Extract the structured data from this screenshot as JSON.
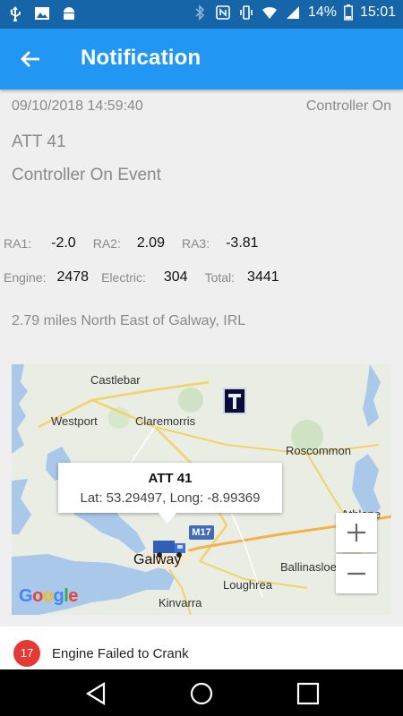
{
  "status_bar": {
    "battery": "14%",
    "time": "15:01"
  },
  "app_bar": {
    "title": "Notification"
  },
  "notification": {
    "timestamp": "09/10/2018 14:59:40",
    "event_type": "Controller On",
    "unit": "ATT 41",
    "event": "Controller On Event",
    "readings_1": [
      {
        "label": "RA1:",
        "value": "-2.0"
      },
      {
        "label": "RA2:",
        "value": "2.09"
      },
      {
        "label": "RA3:",
        "value": "-3.81"
      }
    ],
    "readings_2": [
      {
        "label": "Engine:",
        "value": "2478"
      },
      {
        "label": "Electric:",
        "value": "304"
      },
      {
        "label": "Total:",
        "value": "3441"
      }
    ],
    "location": "2.79 miles North East of Galway, IRL"
  },
  "map": {
    "towns": {
      "castlebar": "Castlebar",
      "westport": "Westport",
      "claremorris": "Claremorris",
      "roscommon": "Roscommon",
      "athlone": "Athlone",
      "ballinasloe": "Ballinasloe",
      "galway": "Galway",
      "loughrea": "Loughrea",
      "kinvarra": "Kinvarra"
    },
    "road": "M17",
    "info_window": {
      "title": "ATT 41",
      "coords": "Lat: 53.29497, Long: -8.99369"
    },
    "zoom_in": "+",
    "zoom_out": "−",
    "attribution": "Google"
  },
  "list": {
    "badge": "17",
    "text": "Engine Failed to Crank"
  }
}
